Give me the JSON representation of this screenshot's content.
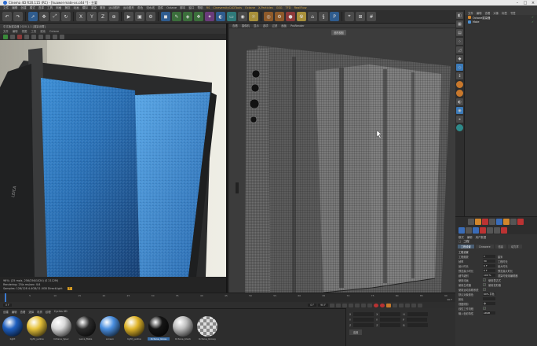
{
  "window": {
    "title": "Cinema 4D R20.115 (RC) - [huawei-mate-xs.c4d *] - 主要",
    "min_icon": "minimize-icon",
    "max_icon": "maximize-icon",
    "close_icon": "close-icon"
  },
  "menu": [
    "文件",
    "编辑",
    "创建",
    "模式",
    "选择",
    "工具",
    "网格",
    "捕捉",
    "动画",
    "模拟",
    "渲染",
    "雕刻",
    "运动跟踪",
    "运动图形",
    "角色",
    "流水线",
    "插件",
    "Octane",
    "脚本",
    "窗口",
    "帮助"
  ],
  "menu_accent": [
    "RS",
    "CineversityC4DTools",
    "Octane",
    "X-Particles",
    "GSG",
    "TFD",
    "RealFlow"
  ],
  "render_view": {
    "title": "中文版渲染器 2020.1.1 [渲染设置]",
    "menu": [
      "文件",
      "编辑",
      "视图",
      "工具",
      "渲染",
      "Octane"
    ],
    "status_line1": "96%: (25 ms/s, 256/256/1024) (S 2112M)",
    "status_line2": "Rendering: 25/s  ms/sec: 0/4",
    "status_line3": "Samples: 128/128  4.4GB/11.0GB  DirectLight",
    "badge": "T"
  },
  "wire_view": {
    "menu": [
      "查看",
      "摄像机",
      "显示",
      "选项",
      "过滤",
      "面板",
      "ProRender"
    ],
    "pill": "透视视图"
  },
  "object_manager": {
    "tabs": [
      "文件",
      "编辑",
      "查看",
      "对象",
      "标签",
      "书签"
    ],
    "objects": [
      {
        "name": "Octane渲染器",
        "icon": "octane-object-icon"
      },
      {
        "name": "Mate",
        "icon": "null-object-icon"
      }
    ]
  },
  "attributes": {
    "modes": [
      "模式",
      "编辑",
      "用户数据"
    ],
    "object_title": "工程",
    "subtabs": [
      "工程设置",
      "Cineware",
      "信息",
      "动力学"
    ],
    "section": "工程设置",
    "rows": [
      {
        "label": "工程缩放",
        "value": "1",
        "unit": "厘米"
      },
      {
        "label": "帧率",
        "value": "30",
        "extra": "工程时长"
      },
      {
        "label": "最小时长",
        "value": "0 F",
        "extra": "最大时长"
      },
      {
        "label": "预览最小时长",
        "value": "0 F",
        "extra": "预览最大时长"
      },
      {
        "label": "细节级别",
        "value": "100 %",
        "extra": "渲染时使用编辑器"
      },
      {
        "label": "使用动画",
        "checked": "✓",
        "extra": "使用表达式"
      },
      {
        "label": "使用生成器",
        "checked": "✓",
        "extra": "使用变形器"
      },
      {
        "label": "使用运动剪辑系统",
        "checked": "✓"
      },
      {
        "label": "默认对象颜色",
        "value": "60% 灰色"
      },
      {
        "label": "颜色",
        "value": ""
      },
      {
        "label": "视图修剪",
        "value": "中"
      },
      {
        "label": "线性工作流程",
        "checked": "✓"
      },
      {
        "label": "输入色彩特性",
        "value": "sRGB"
      }
    ]
  },
  "timeline": {
    "ticks": [
      "0",
      "5",
      "10",
      "15",
      "20",
      "25",
      "30",
      "35",
      "40",
      "45",
      "50",
      "55",
      "60",
      "65",
      "70",
      "75",
      "80",
      "85",
      "90"
    ],
    "end_label": "90 F",
    "current": "0 F",
    "start": "0 F",
    "end": "90 F"
  },
  "materials": {
    "tabs": [
      "创建",
      "编辑",
      "查看",
      "选择",
      "材质",
      "纹理",
      "Cycles 4D"
    ],
    "items": [
      {
        "name": "light",
        "color": "#1f5fbf"
      },
      {
        "name": "light_yellow",
        "color": "#e6c23a"
      },
      {
        "name": "Octane_Spec",
        "color": "#d8d8d8"
      },
      {
        "name": "Leica_Mate",
        "color": "#2b2b2b"
      },
      {
        "name": "screen",
        "color": "#4a8fe0"
      },
      {
        "name": "light_yellow",
        "color": "#e0b52a"
      },
      {
        "name": "Octane_Gloss",
        "color": "#151515"
      },
      {
        "name": "Octane_black",
        "color": "#bdbdbd"
      },
      {
        "name": "Octane_Glossy",
        "color": "#e4e4e4"
      }
    ]
  },
  "coords": {
    "labels": [
      "X",
      "Y",
      "Z"
    ],
    "labels2": [
      "H",
      "P",
      "B"
    ],
    "apply": "应用"
  }
}
